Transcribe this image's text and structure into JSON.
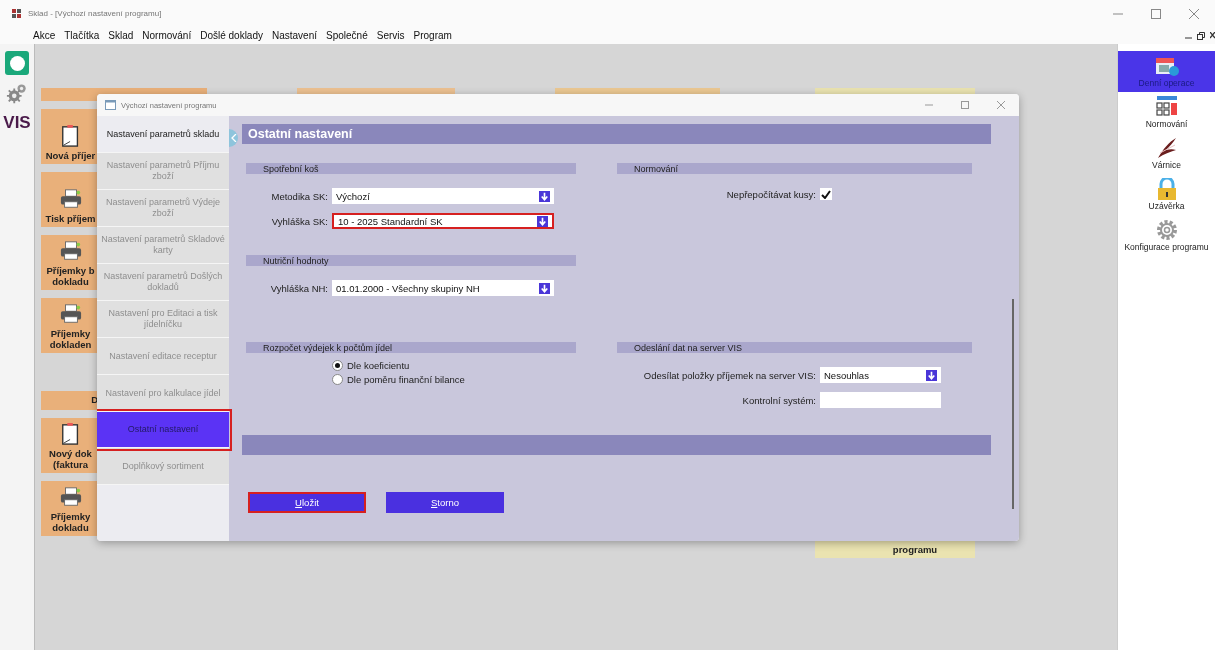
{
  "app": {
    "title": "Sklad - [Výchozí nastavení programu]"
  },
  "menu": [
    "Akce",
    "Tlačítka",
    "Sklad",
    "Normování",
    "Došlé doklady",
    "Nastavení",
    "Společné",
    "Servis",
    "Program"
  ],
  "left_strip": {
    "logo": "VIS"
  },
  "tiles": [
    {
      "kind": "document",
      "lines": [
        "Nová příjer"
      ]
    },
    {
      "kind": "printer",
      "lines": [
        "Tisk příjem"
      ]
    },
    {
      "kind": "printer",
      "lines": [
        "Příjemky b",
        "dokladu"
      ]
    },
    {
      "kind": "printer",
      "lines": [
        "Příjemky",
        "dokladen"
      ]
    },
    {
      "kind": "header",
      "lines": [
        "D"
      ]
    },
    {
      "kind": "document",
      "lines": [
        "Nový dok",
        "(faktura"
      ]
    },
    {
      "kind": "printer",
      "lines": [
        "Příjemky",
        "dokladu"
      ]
    }
  ],
  "corner_tile": "programu",
  "right_panel": [
    {
      "label": "Denní operace",
      "kind": "calendar",
      "selected": true
    },
    {
      "label": "Normování",
      "kind": "calculator",
      "selected": false
    },
    {
      "label": "Várnice",
      "kind": "feather",
      "selected": false
    },
    {
      "label": "Uzávěrka",
      "kind": "lock",
      "selected": false
    },
    {
      "label": "Konfigurace programu",
      "kind": "gear",
      "selected": false
    }
  ],
  "dialog": {
    "title": "Výchozí nastavení programu",
    "nav": [
      {
        "label": "Nastavení parametrů skladu",
        "selected": false,
        "disabled": false,
        "highlighted": false
      },
      {
        "label": "Nastavení parametrů Příjmu zboží",
        "selected": false,
        "disabled": true,
        "highlighted": false
      },
      {
        "label": "Nastavení parametrů Výdeje zboží",
        "selected": false,
        "disabled": true,
        "highlighted": false
      },
      {
        "label": "Nastavení parametrů Skladové karty",
        "selected": false,
        "disabled": true,
        "highlighted": false
      },
      {
        "label": "Nastavení parametrů Došlých dokladů",
        "selected": false,
        "disabled": true,
        "highlighted": false
      },
      {
        "label": "Nastavení pro Editaci a tisk jídelníčku",
        "selected": false,
        "disabled": true,
        "highlighted": false
      },
      {
        "label": "Nastavení editace receptur",
        "selected": false,
        "disabled": true,
        "highlighted": false
      },
      {
        "label": "Nastavení pro kalkulace jídel",
        "selected": false,
        "disabled": true,
        "highlighted": false
      },
      {
        "label": "Ostatní nastavení",
        "selected": true,
        "disabled": false,
        "highlighted": true
      },
      {
        "label": "Doplňkový sortiment",
        "selected": false,
        "disabled": true,
        "highlighted": false
      }
    ],
    "heading": "Ostatní nastavení",
    "rows": [
      [
        {
          "title": "Spotřební koš",
          "fields": [
            {
              "kind": "select",
              "label": "Metodika SK:",
              "value": "Výchozí",
              "highlighted": false
            },
            {
              "kind": "select",
              "label": "Vyhláška SK:",
              "value": "10 - 2025 Standardní SK",
              "highlighted": true
            }
          ]
        },
        {
          "title": "Normování",
          "fields": [
            {
              "kind": "checkbox",
              "label": "Nepřepočítávat kusy:",
              "checked": true
            }
          ]
        }
      ],
      [
        {
          "title": "Nutriční hodnoty",
          "fields": [
            {
              "kind": "select",
              "label": "Vyhláška NH:",
              "value": "01.01.2000 - Všechny skupiny NH",
              "highlighted": false
            }
          ]
        }
      ],
      [
        {
          "title": "Rozpočet výdejek k počtům jídel",
          "fields": [
            {
              "kind": "radio",
              "label": "Dle koeficientu",
              "selected": true
            },
            {
              "kind": "radio",
              "label": "Dle poměru finanční bilance",
              "selected": false
            }
          ]
        },
        {
          "title": "Odeslání dat na server VIS",
          "fields": [
            {
              "kind": "select",
              "label": "Odesílat položky příjemek na server VIS:",
              "value": "Nesouhlas",
              "highlighted": false
            },
            {
              "kind": "text",
              "label": "Kontrolní systém:"
            }
          ]
        }
      ]
    ],
    "buttons": [
      {
        "label": "Uložit",
        "highlighted": true
      },
      {
        "label": "Storno",
        "highlighted": false
      }
    ]
  }
}
